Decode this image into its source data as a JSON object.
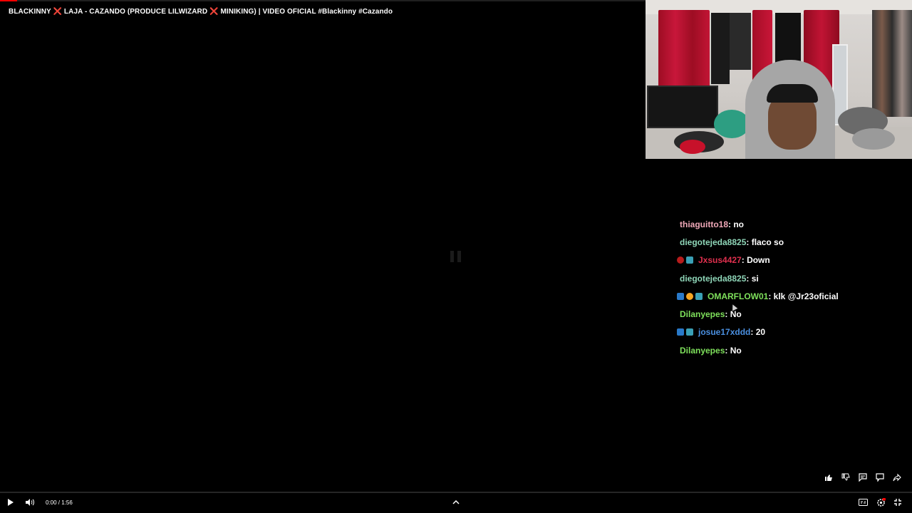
{
  "video": {
    "title_parts": [
      "BLACKINNY ",
      "❌",
      " LAJA - CAZANDO (PRODUCE LILWIZARD ",
      "❌",
      " MINIKING) | VIDEO OFICIAL #Blackinny #Cazando"
    ],
    "time_display": "0:00 / 1:56",
    "progress": 0.0,
    "accent_color": "#ff0000"
  },
  "chat": {
    "messages": [
      {
        "badges": [],
        "user": "thiaguitto18",
        "color": "#f0a8b8",
        "text": " : no"
      },
      {
        "badges": [],
        "user": "diegotejeda8825",
        "color": "#8fd6b8",
        "text": " : flaco so"
      },
      {
        "badges": [
          "red",
          "grid"
        ],
        "user": "Jxsus4427",
        "color": "#e0304e",
        "text": " : Down"
      },
      {
        "badges": [],
        "user": "diegotejeda8825",
        "color": "#8fd6b8",
        "text": " : si"
      },
      {
        "badges": [
          "blue",
          "orange",
          "grid"
        ],
        "user": "OMARFLOW01",
        "color": "#7ee05b",
        "text": " : klk @Jr23oficial"
      },
      {
        "badges": [],
        "user": "Dilanyepes",
        "color": "#7ee05b",
        "text": " : No"
      },
      {
        "badges": [
          "blue",
          "grid"
        ],
        "user": "josue17xddd",
        "color": "#4a8fe0",
        "text": " : 20"
      },
      {
        "badges": [],
        "user": "Dilanyepes",
        "color": "#7ee05b",
        "text": " : No"
      }
    ]
  },
  "icons": {
    "like": "thumbs-up-icon",
    "dislike": "thumbs-down-icon",
    "comments": "comment-icon",
    "chat": "chat-icon",
    "share": "share-icon",
    "play": "play-icon",
    "volume": "volume-icon",
    "expand": "chevron-up-icon",
    "captions": "captions-icon",
    "settings": "settings-icon",
    "exit_fullscreen": "exit-fullscreen-icon"
  }
}
